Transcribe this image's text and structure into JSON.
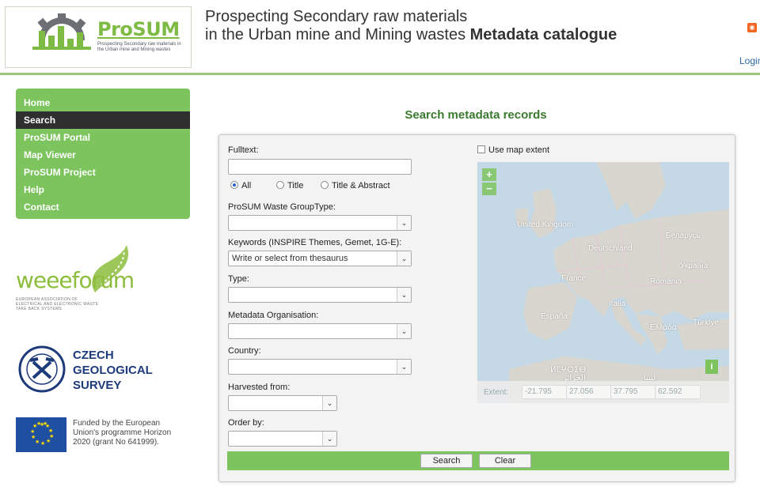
{
  "header": {
    "logo_text": "ProSUM",
    "logo_subtext": "Prospecting Secondary raw materials in the Urban mine and Mining wastes",
    "title_line1": "Prospecting Secondary raw materials",
    "title_line2": "in the Urban mine and Mining wastes",
    "title_bold": "Metadata catalogue",
    "login_label": "Login",
    "rss_icon": "rss-icon"
  },
  "nav": {
    "items": [
      {
        "label": "Home"
      },
      {
        "label": "Search"
      },
      {
        "label": "ProSUM Portal"
      },
      {
        "label": "Map Viewer"
      },
      {
        "label": "ProSUM Project"
      },
      {
        "label": "Help"
      },
      {
        "label": "Contact"
      }
    ],
    "active_index": 1
  },
  "sidebar_logos": {
    "weee_word": "weeeforum",
    "weee_small": "EUROPEAN ASSOCIATION OF ELECTRICAL AND ELECTRONIC WASTE TAKE BACK SYSTEMS",
    "cgs_line1": "CZECH",
    "cgs_line2": "GEOLOGICAL",
    "cgs_line3": "SURVEY",
    "eu_text": "Funded by the European Union's programme Horizon 2020 (grant No 641999)."
  },
  "search": {
    "heading": "Search metadata records",
    "fulltext_label": "Fulltext:",
    "fulltext_value": "",
    "radios": [
      {
        "label": "All",
        "selected": true
      },
      {
        "label": "Title",
        "selected": false
      },
      {
        "label": "Title & Abstract",
        "selected": false
      }
    ],
    "waste_group_label": "ProSUM Waste GroupType:",
    "waste_group_value": "",
    "keywords_label": "Keywords (INSPIRE Themes, Gemet, 1G-E):",
    "keywords_placeholder": "Write or select from thesaurus",
    "type_label": "Type:",
    "type_value": "",
    "org_label": "Metadata Organisation:",
    "org_value": "",
    "country_label": "Country:",
    "country_value": "",
    "harvested_label": "Harvested from:",
    "harvested_value": "",
    "order_label": "Order by:",
    "order_value": "",
    "use_map_extent_label": "Use map extent",
    "use_map_extent_checked": false,
    "search_button": "Search",
    "clear_button": "Clear"
  },
  "map": {
    "zoom_in": "+",
    "zoom_out": "−",
    "info_button": "i",
    "extent_label": "Extent:",
    "extent_values": [
      "-21.795",
      "27.056",
      "37.795",
      "62.592"
    ],
    "place_labels": [
      "United Kingdom",
      "Беларусь",
      "Deutschland",
      "Україна",
      "France",
      "România",
      "Italia",
      "España",
      "Ελλάδα",
      "Türkiye",
      "ⵍⵎⵖⵔⵉⴱ",
      "الجزائر",
      "ليبيا"
    ],
    "land_color": "#d8d6cf",
    "sea_color": "#c5d8e5"
  },
  "colors": {
    "accent_green": "#7dc45f",
    "heading_green": "#3a7a2e",
    "nav_active": "#2f2f2f"
  }
}
